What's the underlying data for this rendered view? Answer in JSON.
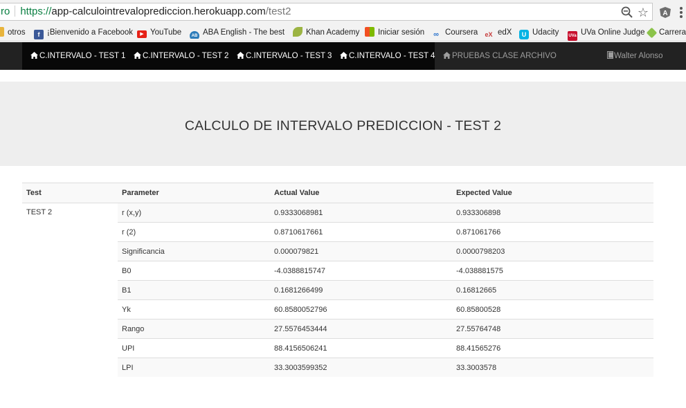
{
  "browser": {
    "secure_fragment": "ro",
    "url_protocol": "https://",
    "url_host": "app-calculointrevaloprediccion.herokuapp.com",
    "url_path": "/test2",
    "bookmarks": [
      {
        "label": "otros",
        "icon": "folder-icon",
        "color": "#e8b43c"
      },
      {
        "label": "¡Bienvenido a Facebook",
        "icon": "facebook-icon",
        "color": "#3b5998"
      },
      {
        "label": "YouTube",
        "icon": "youtube-icon",
        "color": "#e62117"
      },
      {
        "label": "ABA English - The best w",
        "icon": "aba-icon",
        "color": "#2b7bb9"
      },
      {
        "label": "Khan Academy",
        "icon": "khan-leaf-icon",
        "color": "#9cb443"
      },
      {
        "label": "Iniciar sesión",
        "icon": "windows-icon",
        "color": "#f25022"
      },
      {
        "label": "Coursera",
        "icon": "coursera-icon",
        "color": "#2a73cc"
      },
      {
        "label": "edX",
        "icon": "edx-icon",
        "color": "#c63b3b"
      },
      {
        "label": "Udacity",
        "icon": "udacity-icon",
        "color": "#02b3e4"
      },
      {
        "label": "UVa Online Judge",
        "icon": "uva-icon",
        "color": "#c8102e"
      },
      {
        "label": "Carrera",
        "icon": "carrera-icon",
        "color": "#8bc34a"
      }
    ]
  },
  "nav": {
    "items": [
      {
        "label": "C.INTERVALO - TEST 1"
      },
      {
        "label": "C.INTERVALO - TEST 2"
      },
      {
        "label": "C.INTERVALO - TEST 3"
      },
      {
        "label": "C.INTERVALO - TEST 4"
      },
      {
        "label": "PRUEBAS CLASE ARCHIVO"
      }
    ],
    "user": "Walter Alonso"
  },
  "page": {
    "title": "CALCULO DE INTERVALO PREDICCION - TEST 2"
  },
  "table": {
    "headers": [
      "Test",
      "Parameter",
      "Actual Value",
      "Expected Value"
    ],
    "test_name": "TEST 2",
    "rows": [
      {
        "parameter": "r (x,y)",
        "actual": "0.9333068981",
        "expected": "0.933306898"
      },
      {
        "parameter": "r (2)",
        "actual": "0.8710617661",
        "expected": "0.871061766"
      },
      {
        "parameter": "Significancia",
        "actual": "0.000079821",
        "expected": "0.0000798203"
      },
      {
        "parameter": "B0",
        "actual": "-4.0388815747",
        "expected": "-4.038881575"
      },
      {
        "parameter": "B1",
        "actual": "0.1681266499",
        "expected": "0.16812665"
      },
      {
        "parameter": "Yk",
        "actual": "60.8580052796",
        "expected": "60.85800528"
      },
      {
        "parameter": "Rango",
        "actual": "27.5576453444",
        "expected": "27.55764748"
      },
      {
        "parameter": "UPI",
        "actual": "88.4156506241",
        "expected": "88.41565276"
      },
      {
        "parameter": "LPI",
        "actual": "33.3003599352",
        "expected": "33.3003578"
      }
    ]
  }
}
